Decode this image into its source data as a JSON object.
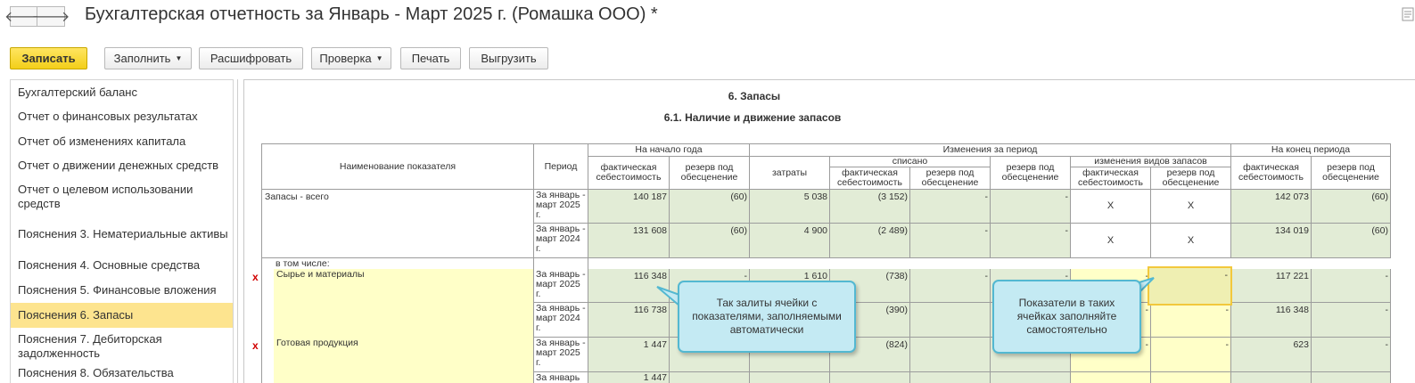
{
  "window": {
    "title": "Бухгалтерская отчетность за Январь - Март 2025 г. (Ромашка ООО) *"
  },
  "nav": {
    "back_icon": "arrow-left-icon",
    "forward_icon": "arrow-right-icon",
    "back_glyph": "🡐",
    "forward_glyph": "🡒"
  },
  "toolbar": {
    "save": "Записать",
    "fill": "Заполнить",
    "decode": "Расшифровать",
    "check": "Проверка",
    "print": "Печать",
    "export": "Выгрузить"
  },
  "sidebar": {
    "items": [
      "Бухгалтерский баланс",
      "Отчет о финансовых результатах",
      "Отчет об изменениях капитала",
      "Отчет о движении денежных средств",
      "Отчет о целевом использовании средств",
      "Пояснения 3. Нематериальные активы",
      "Пояснения 4. Основные средства",
      "Пояснения 5. Финансовые вложения",
      "Пояснения 6. Запасы",
      "Пояснения 7. Дебиторская задолженность",
      "Пояснения 8. Обязательства"
    ],
    "active_index": 8
  },
  "report": {
    "section_title": "6. Запасы",
    "subtitle": "6.1. Наличие и движение запасов",
    "headers": {
      "name": "Наименование показателя",
      "period": "Период",
      "start_of_year": "На начало года",
      "changes": "Изменения за период",
      "written_off": "списано",
      "type_changes": "изменения видов запасов",
      "end_of_period": "На конец периода",
      "actual_cost": "фактическая себестоимость",
      "impairment_reserve": "резерв под обесценение",
      "costs": "затраты"
    },
    "rows": {
      "total_label": "Запасы - всего",
      "including": "в том числе:",
      "raw_label": "Сырье и материалы",
      "finished_label": "Готовая продукция",
      "period_2025": "За январь - март 2025 г.",
      "period_2024": "За январь - март 2024 г.",
      "period_partial": "За январь",
      "mark": "x",
      "dash": "-",
      "x_mark": "X",
      "total_2025": {
        "start_cost": "140 187",
        "start_reserve": "(60)",
        "costs": "5 038",
        "wo_cost": "(3 152)",
        "end_cost": "142 073",
        "end_reserve": "(60)"
      },
      "total_2024": {
        "start_cost": "131 608",
        "start_reserve": "(60)",
        "costs": "4 900",
        "wo_cost": "(2 489)",
        "end_cost": "134 019",
        "end_reserve": "(60)"
      },
      "raw_2025": {
        "start_cost": "116 348",
        "costs": "1 610",
        "wo_cost": "(738)",
        "end_cost": "117 221"
      },
      "raw_2024": {
        "start_cost": "116 738",
        "wo_cost": "(390)",
        "end_cost": "116 348"
      },
      "fin_2025": {
        "start_cost": "1 447",
        "wo_cost": "(824)",
        "end_cost": "623"
      },
      "fin_2024": {
        "start_cost": "1 447"
      }
    }
  },
  "callouts": {
    "auto": "Так залиты ячейки с показателями, заполняемыми автоматически",
    "manual": "Показатели в таких ячейках заполняйте самостоятельно"
  },
  "colors": {
    "auto_cell": "#e2ecd6",
    "manual_cell": "#ffffc8",
    "active_sidebar": "#fde48f",
    "save_button": "#f3cf19",
    "callout_bg": "#c4eaf3"
  }
}
